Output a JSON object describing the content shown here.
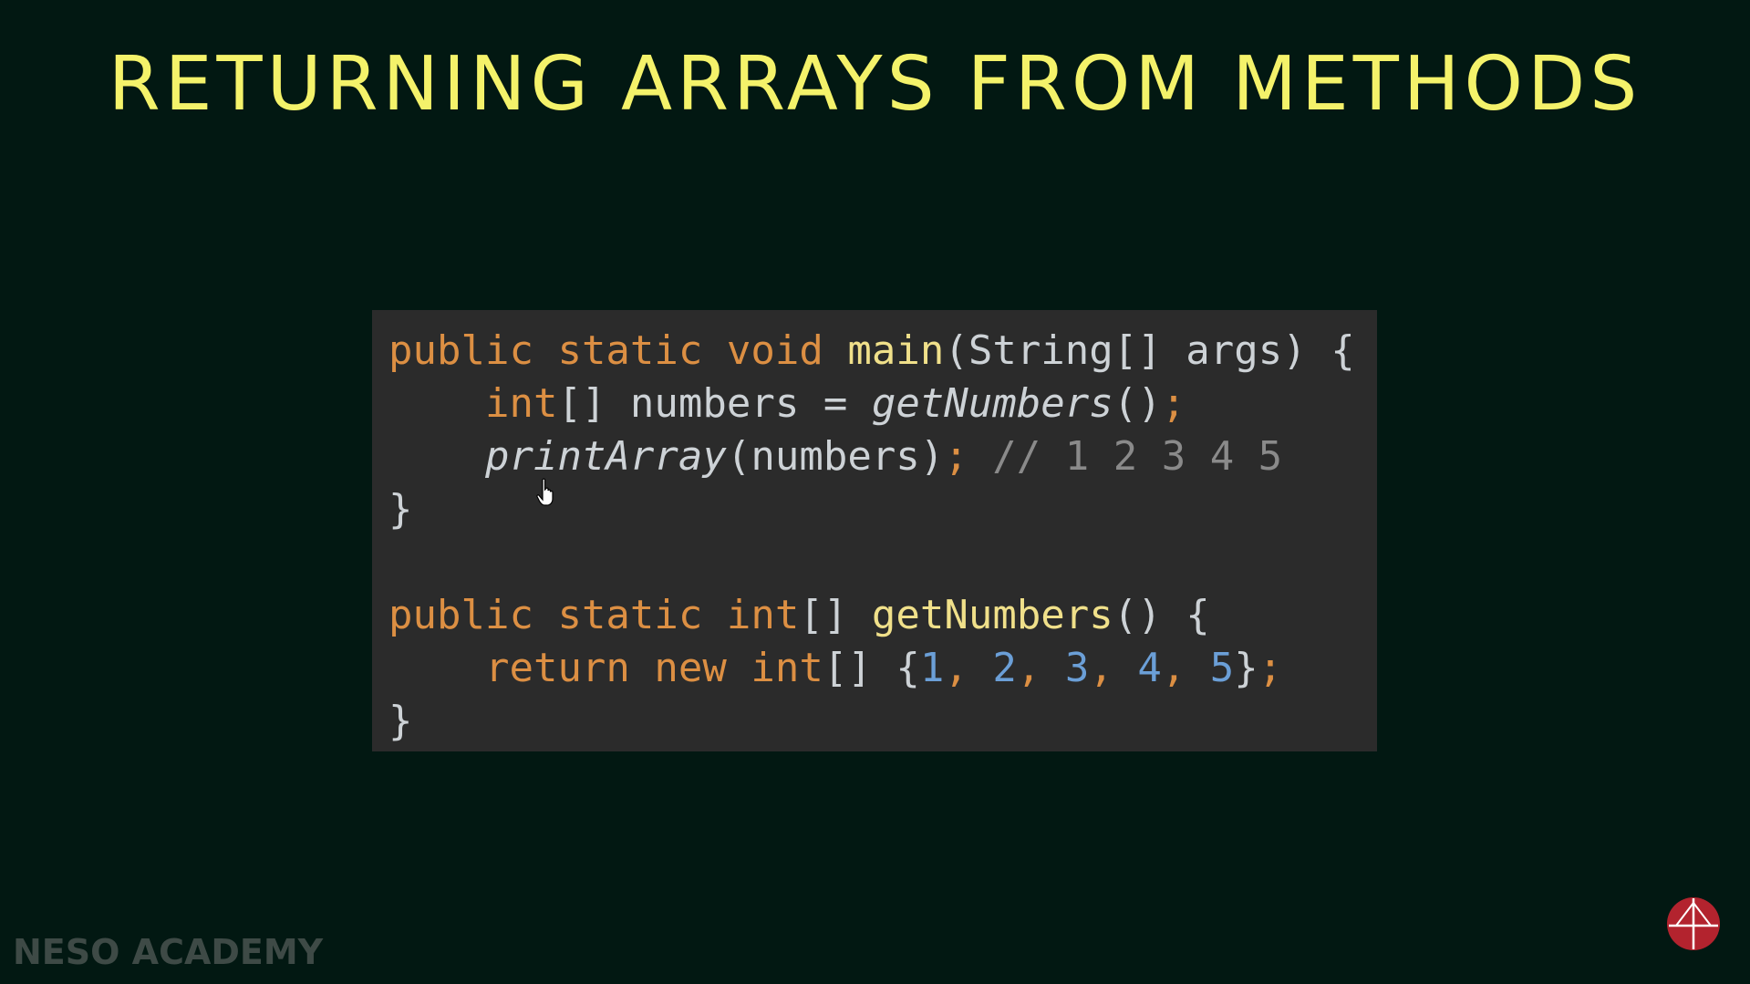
{
  "slide": {
    "title": "RETURNING ARRAYS FROM METHODS",
    "watermark": "NESO ACADEMY"
  },
  "code": {
    "line1": {
      "public": "public",
      "static": "static",
      "void": "void",
      "main": "main",
      "rest": "(String[] args) {"
    },
    "line2": {
      "indent": "    ",
      "int": "int",
      "mid": "[] numbers = ",
      "call": "getNumbers",
      "paren": "()",
      "semi": ";"
    },
    "line3": {
      "indent": "    ",
      "call": "printArray",
      "args": "(numbers)",
      "semi": ";",
      "comment": " // 1 2 3 4 5"
    },
    "line4": {
      "brace": "}"
    },
    "line6": {
      "public": "public",
      "static": "static",
      "int": "int",
      "brackets": "[] ",
      "fn": "getNumbers",
      "rest": "() {"
    },
    "line7": {
      "indent": "    ",
      "return": "return",
      "new": "new",
      "int": "int",
      "brackets": "[] {",
      "n1": "1",
      "n2": "2",
      "n3": "3",
      "n4": "4",
      "n5": "5",
      "sep": ", ",
      "close": "}",
      "semi": ";"
    },
    "line8": {
      "brace": "}"
    }
  },
  "colors": {
    "background": "#021812",
    "title": "#f4f26a",
    "code_background": "#2b2b2b",
    "keyword": "#dc8f43",
    "method_name": "#f0e08a",
    "number": "#6b9fd7",
    "comment": "#8a8a8a",
    "watermark": "#3e4a46",
    "logo": "#b3232e"
  },
  "icons": {
    "cursor": "hand-pointer-cursor",
    "logo": "neso-academy-logo"
  }
}
